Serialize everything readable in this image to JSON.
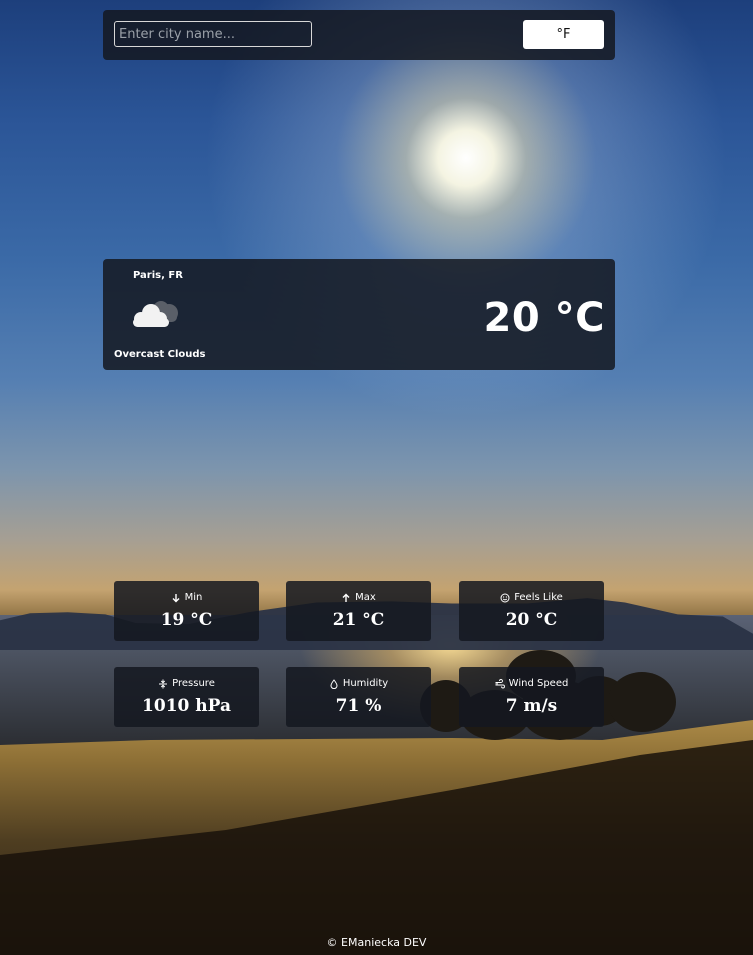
{
  "search": {
    "placeholder": "Enter city name...",
    "value": "",
    "unit_toggle_label": "°F"
  },
  "current": {
    "location": "Paris, FR",
    "icon": "overcast-clouds-icon",
    "condition": "Overcast Clouds",
    "temperature": "20 °C"
  },
  "stats": [
    {
      "label": "Min",
      "icon": "arrow-down-icon",
      "value": "19 °C"
    },
    {
      "label": "Max",
      "icon": "arrow-up-icon",
      "value": "21 °C"
    },
    {
      "label": "Feels Like",
      "icon": "smiley-icon",
      "value": "20 °C"
    },
    {
      "label": "Pressure",
      "icon": "pressure-icon",
      "value": "1010 hPa"
    },
    {
      "label": "Humidity",
      "icon": "droplet-icon",
      "value": "71 %"
    },
    {
      "label": "Wind Speed",
      "icon": "wind-icon",
      "value": "7 m/s"
    }
  ],
  "footer": {
    "text": "© EManiecka DEV"
  },
  "colors": {
    "panel": "#141820",
    "text": "#ffffff",
    "button": "#ffffff"
  }
}
